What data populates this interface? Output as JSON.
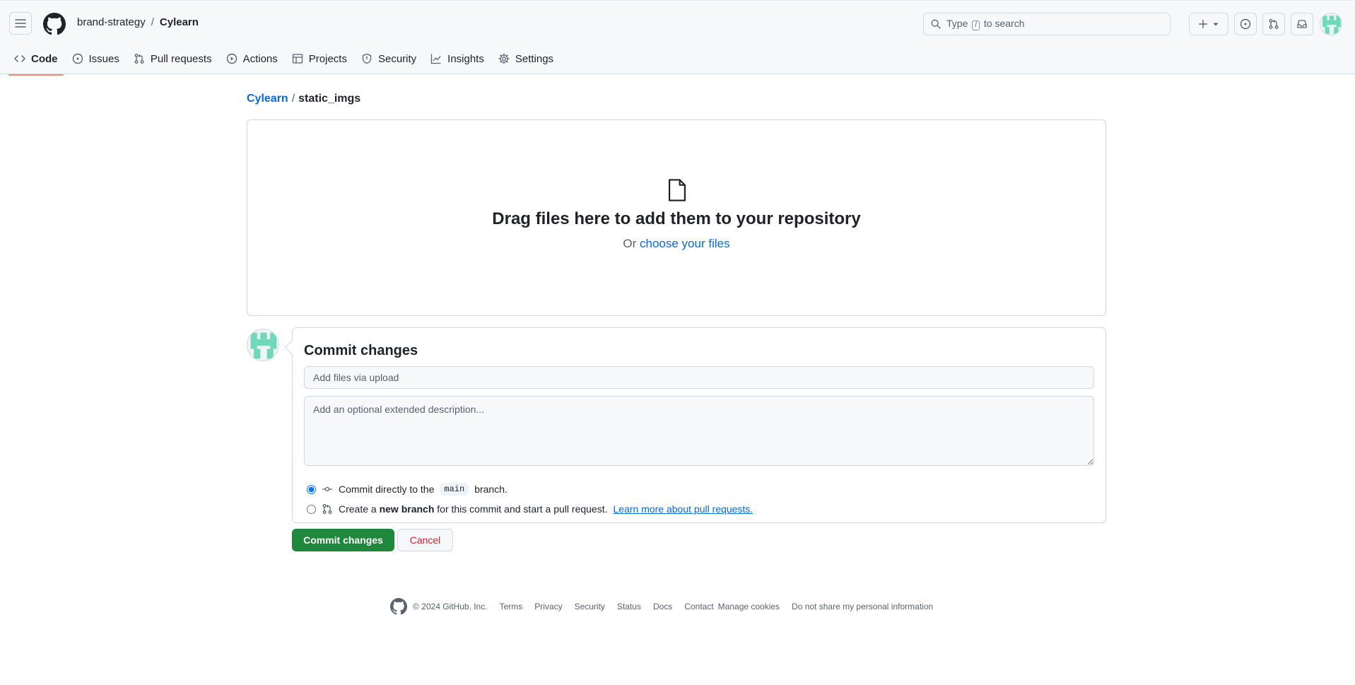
{
  "header": {
    "owner": "brand-strategy",
    "separator": "/",
    "repo": "Cylearn",
    "search_prefix": "Type",
    "search_key": "/",
    "search_suffix": "to search"
  },
  "nav": {
    "items": [
      {
        "label": "Code",
        "icon": "code-icon"
      },
      {
        "label": "Issues",
        "icon": "issue-opened-icon"
      },
      {
        "label": "Pull requests",
        "icon": "git-pull-request-icon"
      },
      {
        "label": "Actions",
        "icon": "play-icon"
      },
      {
        "label": "Projects",
        "icon": "table-icon"
      },
      {
        "label": "Security",
        "icon": "shield-icon"
      },
      {
        "label": "Insights",
        "icon": "graph-icon"
      },
      {
        "label": "Settings",
        "icon": "gear-icon"
      }
    ],
    "active": "Code"
  },
  "path": {
    "repo": "Cylearn",
    "separator": "/",
    "directory": "static_imgs"
  },
  "dropzone": {
    "title": "Drag files here to add them to your repository",
    "prefix": "Or",
    "link": "choose your files"
  },
  "commit": {
    "title": "Commit changes",
    "summary_placeholder": "Add files via upload",
    "description_placeholder": "Add an optional extended description...",
    "option_direct": {
      "prefix": "Commit directly to the",
      "branch": "main",
      "suffix": "branch."
    },
    "option_new": {
      "prefix": "Create a",
      "bold": "new branch",
      "suffix": "for this commit and start a pull request.",
      "link": "Learn more about pull requests."
    },
    "selected": "direct",
    "submit_label": "Commit changes",
    "cancel_label": "Cancel"
  },
  "footer": {
    "copyright": "© 2024 GitHub, Inc.",
    "links": [
      "Terms",
      "Privacy",
      "Security",
      "Status",
      "Docs",
      "Contact",
      "Manage cookies",
      "Do not share my personal information"
    ]
  },
  "colors": {
    "accent_link": "#0969da",
    "primary_button": "#1f883d",
    "danger_text": "#d1242f",
    "active_tab_underline": "#fd8c73",
    "avatar_green": "#6fd8b8"
  }
}
